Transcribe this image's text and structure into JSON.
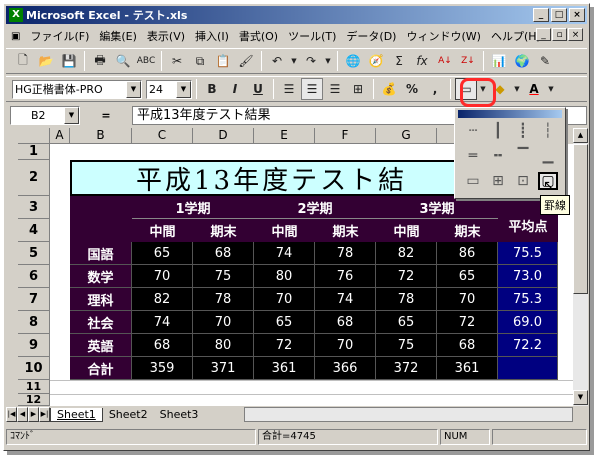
{
  "window": {
    "title": "Microsoft Excel - テスト.xls"
  },
  "menu": [
    "ファイル(F)",
    "編集(E)",
    "表示(V)",
    "挿入(I)",
    "書式(O)",
    "ツール(T)",
    "データ(D)",
    "ウィンドウ(W)",
    "ヘルプ(H)"
  ],
  "toolbar": {
    "font_name": "HG正楷書体-PRO",
    "font_size": "24",
    "bold": "B",
    "italic": "I",
    "underline": "U",
    "percent": "%",
    "comma": ","
  },
  "formula_bar": {
    "name_box": "B2",
    "equals": "=",
    "content": "平成13年度テスト結果"
  },
  "columns": [
    "A",
    "B",
    "C",
    "D",
    "E",
    "F",
    "G"
  ],
  "rows": [
    "1",
    "2",
    "3",
    "4",
    "5",
    "6",
    "7",
    "8",
    "9",
    "10",
    "11",
    "12"
  ],
  "sheet": {
    "title": "平成13年度テスト結",
    "term_headers": [
      "1学期",
      "2学期",
      "3学期"
    ],
    "sub_headers": [
      "中間",
      "期末",
      "中間",
      "期末",
      "中間",
      "期末"
    ],
    "avg_header": "平均点",
    "subjects": [
      {
        "name": "国語",
        "scores": [
          "65",
          "68",
          "74",
          "78",
          "82",
          "86"
        ],
        "avg": "75.5"
      },
      {
        "name": "数学",
        "scores": [
          "70",
          "75",
          "80",
          "76",
          "72",
          "65"
        ],
        "avg": "73.0"
      },
      {
        "name": "理科",
        "scores": [
          "82",
          "78",
          "70",
          "74",
          "78",
          "70"
        ],
        "avg": "75.3"
      },
      {
        "name": "社会",
        "scores": [
          "74",
          "70",
          "65",
          "68",
          "65",
          "72"
        ],
        "avg": "69.0"
      },
      {
        "name": "英語",
        "scores": [
          "68",
          "80",
          "72",
          "70",
          "75",
          "68"
        ],
        "avg": "72.2"
      }
    ],
    "total": {
      "name": "合計",
      "scores": [
        "359",
        "371",
        "361",
        "366",
        "372",
        "361"
      ]
    }
  },
  "sheet_tabs": [
    "Sheet1",
    "Sheet2",
    "Sheet3"
  ],
  "status": {
    "mode": "ｺﾏﾝﾄﾞ",
    "sum": "合計=4745",
    "num": "NUM"
  },
  "tooltip": "罫線",
  "colors": {
    "title_bg": "#ccffff",
    "header_bg": "#330033",
    "data_bg": "#000000",
    "avg_bg": "#000080",
    "highlight": "#ff2a2a"
  }
}
